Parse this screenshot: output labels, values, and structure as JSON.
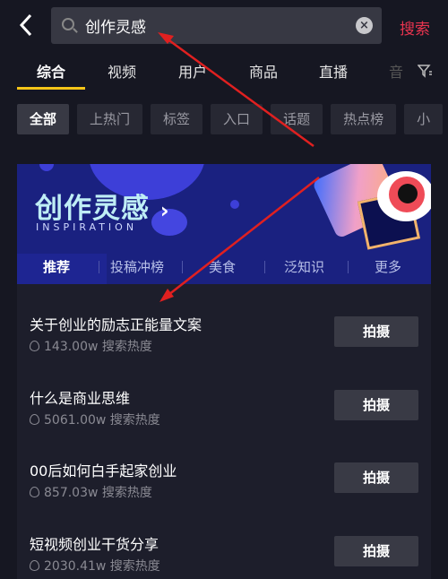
{
  "header": {
    "search_value": "创作灵感",
    "search_button": "搜索",
    "accent": "#e8344f"
  },
  "tabs": [
    {
      "label": "综合"
    },
    {
      "label": "视频"
    },
    {
      "label": "用户"
    },
    {
      "label": "商品"
    },
    {
      "label": "直播"
    },
    {
      "label": "音"
    }
  ],
  "chips": [
    {
      "label": "全部"
    },
    {
      "label": "上热门"
    },
    {
      "label": "标签"
    },
    {
      "label": "入口"
    },
    {
      "label": "话题"
    },
    {
      "label": "热点榜"
    },
    {
      "label": "小"
    }
  ],
  "banner": {
    "title": "创作灵感",
    "subtitle": "INSPIRATION",
    "chevron": "›",
    "tabs": [
      {
        "label": "推荐"
      },
      {
        "label": "投稿冲榜"
      },
      {
        "label": "美食"
      },
      {
        "label": "泛知识"
      },
      {
        "label": "更多"
      }
    ]
  },
  "items": [
    {
      "title": "关于创业的励志正能量文案",
      "heat": "143.00w 搜索热度",
      "action": "拍摄"
    },
    {
      "title": "什么是商业思维",
      "heat": "5061.00w 搜索热度",
      "action": "拍摄"
    },
    {
      "title": "00后如何白手起家创业",
      "heat": "857.03w 搜索热度",
      "action": "拍摄"
    },
    {
      "title": "短视频创业干货分享",
      "heat": "2030.41w 搜索热度",
      "action": "拍摄"
    }
  ],
  "annotation_color": "#e02020"
}
